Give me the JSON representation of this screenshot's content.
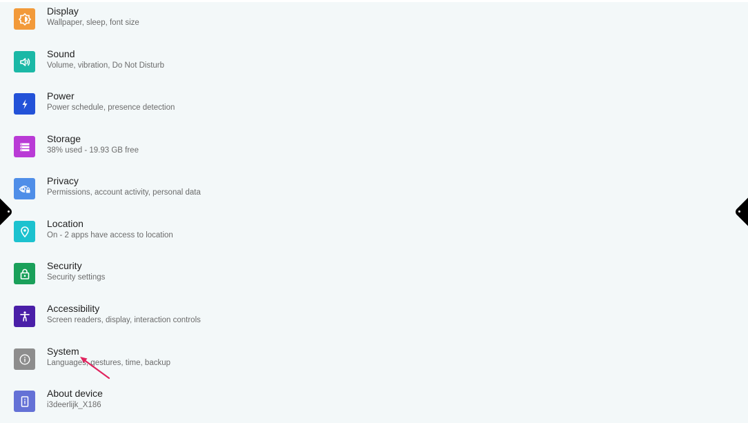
{
  "settings": {
    "items": [
      {
        "title": "Display",
        "subtitle": "Wallpaper, sleep, font size",
        "icon": "display-brightness-icon",
        "color": "#f29a3a"
      },
      {
        "title": "Sound",
        "subtitle": "Volume, vibration, Do Not Disturb",
        "icon": "volume-icon",
        "color": "#1bb8a6"
      },
      {
        "title": "Power",
        "subtitle": "Power schedule, presence detection",
        "icon": "lightning-bolt-icon",
        "color": "#2352d8"
      },
      {
        "title": "Storage",
        "subtitle": "38% used - 19.93 GB free",
        "icon": "storage-list-icon",
        "color": "#b93bd6"
      },
      {
        "title": "Privacy",
        "subtitle": "Permissions, account activity, personal data",
        "icon": "privacy-eye-lock-icon",
        "color": "#4f8ee8"
      },
      {
        "title": "Location",
        "subtitle": "On - 2 apps have access to location",
        "icon": "location-pin-icon",
        "color": "#1cc2cf"
      },
      {
        "title": "Security",
        "subtitle": "Security settings",
        "icon": "lock-icon",
        "color": "#1aa05a"
      },
      {
        "title": "Accessibility",
        "subtitle": "Screen readers, display, interaction controls",
        "icon": "accessibility-person-icon",
        "color": "#4a1fa8"
      },
      {
        "title": "System",
        "subtitle": "Languages, gestures, time, backup",
        "icon": "info-icon",
        "color": "#8d8d8d"
      },
      {
        "title": "About device",
        "subtitle": "i3deerlijk_X186",
        "icon": "device-icon",
        "color": "#6471d6"
      }
    ]
  },
  "colors": {
    "background": "#f3f8f9",
    "annotation_arrow": "#e0245e"
  }
}
